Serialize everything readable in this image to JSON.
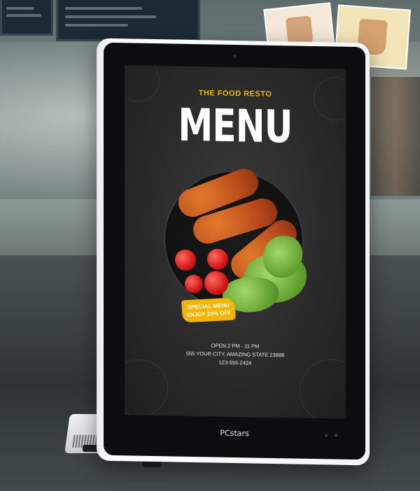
{
  "screen": {
    "brand_name": "THE FOOD RESTO",
    "menu_title": "MENU",
    "promo": {
      "line1": "SPECIAL MENU",
      "line2": "ENJOY 20% OFF"
    },
    "info": {
      "hours": "OPEN 2 PM - 11 PM",
      "address": "555 YOUR CITY, AMAZING STATE 23888",
      "phone": "123-555-2424"
    }
  },
  "device": {
    "logo": "PCstars"
  },
  "colors": {
    "accent": "#f5b400",
    "screen_bg": "#2a2a2a",
    "bezel": "#0c0d0f"
  }
}
